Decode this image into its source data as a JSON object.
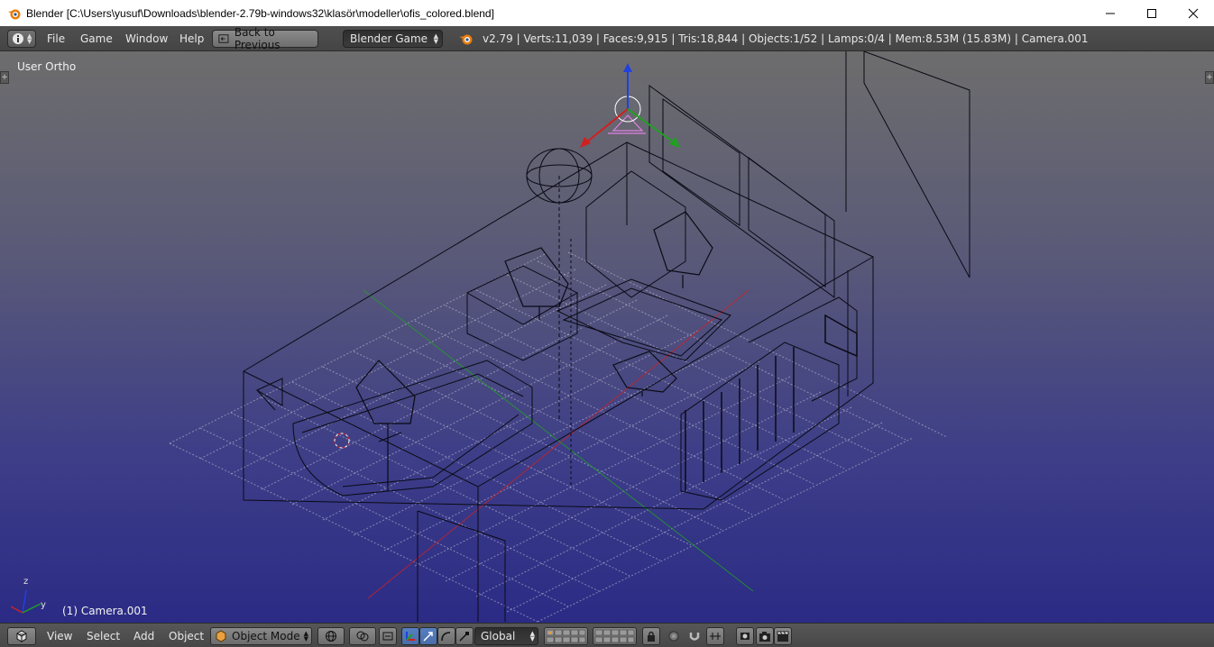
{
  "window": {
    "title": "Blender [C:\\Users\\yusuf\\Downloads\\blender-2.79b-windows32\\klasör\\modeller\\ofis_colored.blend]"
  },
  "info_header": {
    "menus": [
      "File",
      "Game",
      "Window",
      "Help"
    ],
    "back_button": "Back to Previous",
    "render_engine": "Blender Game",
    "stats": "v2.79 | Verts:11,039 | Faces:9,915 | Tris:18,844 | Objects:1/52 | Lamps:0/4 | Mem:8.53M (15.83M) | Camera.001"
  },
  "viewport": {
    "view_name": "User Ortho",
    "active_object": "(1) Camera.001",
    "axis_labels": {
      "z": "z",
      "y": "y"
    }
  },
  "view_header": {
    "menus": [
      "View",
      "Select",
      "Add",
      "Object"
    ],
    "mode": "Object Mode",
    "orientation": "Global"
  },
  "colors": {
    "axis_x": "#d02020",
    "axis_y": "#20a020",
    "axis_z": "#2040e0",
    "wire": "#0a0a14",
    "camera": "#e080e0"
  }
}
